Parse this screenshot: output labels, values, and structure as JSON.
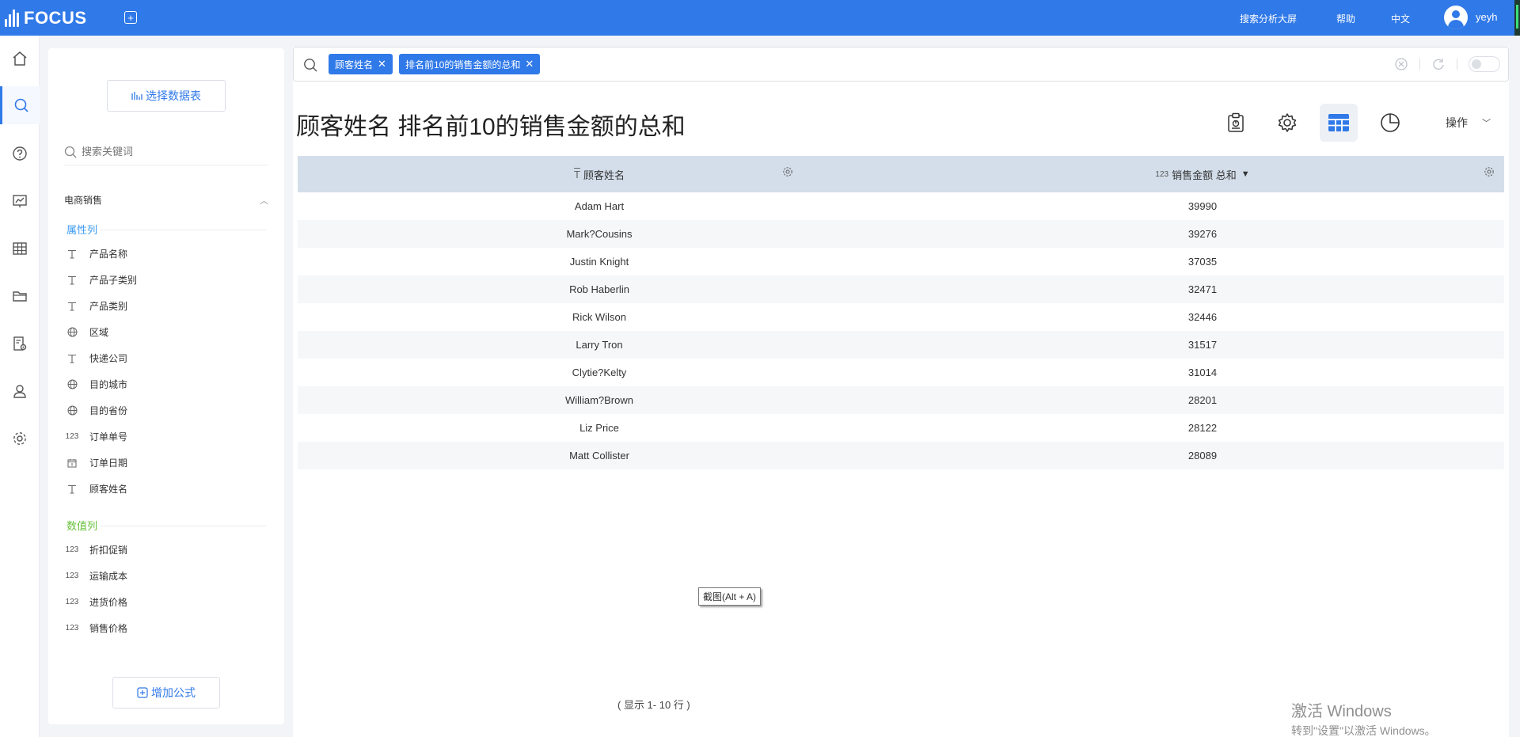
{
  "app": {
    "logo_text": "FOCUS",
    "top_nav": [
      "搜索分析大屏",
      "帮助",
      "中文"
    ],
    "username": "yeyh"
  },
  "left_nav": [
    "home-icon",
    "search-icon",
    "help-icon",
    "dashboard-icon",
    "table-icon",
    "folder-icon",
    "report-settings-icon",
    "user-icon",
    "gear-icon"
  ],
  "panel": {
    "select_table_label": "选择数据表",
    "search_placeholder": "搜索关键词",
    "group_name": "电商销售",
    "attribute_section": "属性列",
    "attribute_fields": [
      {
        "icon": "text-icon",
        "name": "产品名称"
      },
      {
        "icon": "text-icon",
        "name": "产品子类别"
      },
      {
        "icon": "text-icon",
        "name": "产品类别"
      },
      {
        "icon": "globe-icon",
        "name": "区域"
      },
      {
        "icon": "text-icon",
        "name": "快递公司"
      },
      {
        "icon": "globe-icon",
        "name": "目的城市"
      },
      {
        "icon": "globe-icon",
        "name": "目的省份"
      },
      {
        "icon": "number-icon",
        "name": "订单单号"
      },
      {
        "icon": "calendar-icon",
        "name": "订单日期"
      },
      {
        "icon": "text-icon",
        "name": "顾客姓名"
      }
    ],
    "numeric_section": "数值列",
    "numeric_fields": [
      {
        "icon": "number-icon",
        "name": "折扣促销"
      },
      {
        "icon": "number-icon",
        "name": "运输成本"
      },
      {
        "icon": "number-icon",
        "name": "进货价格"
      },
      {
        "icon": "number-icon",
        "name": "销售价格"
      }
    ],
    "add_formula_label": "增加公式"
  },
  "search": {
    "tags": [
      "顾客姓名",
      "排名前10的销售金额的总和"
    ]
  },
  "result": {
    "title": "顾客姓名 排名前10的销售金额的总和",
    "ops_label": "操作"
  },
  "table": {
    "columns": [
      {
        "type_icon": "T",
        "label": "顾客姓名"
      },
      {
        "type_icon": "123",
        "label": "销售金额 总和",
        "sort": "▼"
      }
    ],
    "rows": [
      [
        "Adam Hart",
        "39990"
      ],
      [
        "Mark?Cousins",
        "39276"
      ],
      [
        "Justin Knight",
        "37035"
      ],
      [
        "Rob Haberlin",
        "32471"
      ],
      [
        "Rick Wilson",
        "32446"
      ],
      [
        "Larry Tron",
        "31517"
      ],
      [
        "Clytie?Kelty",
        "31014"
      ],
      [
        "William?Brown",
        "28201"
      ],
      [
        "Liz Price",
        "28122"
      ],
      [
        "Matt Collister",
        "28089"
      ]
    ],
    "row_count_text": "( 显示 1- 10 行 )"
  },
  "tooltip": "截图(Alt + A)",
  "watermark": {
    "line1": "激活 Windows",
    "line2": "转到\"设置\"以激活 Windows。"
  },
  "colors": {
    "brand": "#3079e8",
    "header_bg": "#d3deea",
    "section_attr": "#3d9bf0",
    "section_num": "#67c23a"
  }
}
